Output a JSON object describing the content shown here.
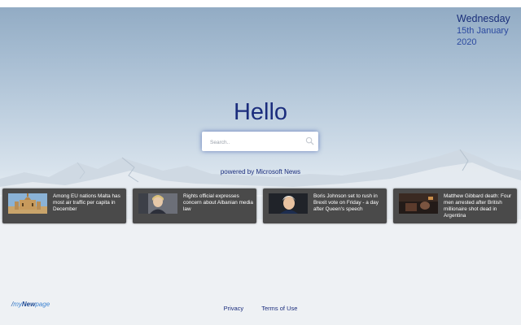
{
  "date": {
    "weekday": "Wednesday",
    "day_month": "15th January",
    "year": "2020"
  },
  "greeting": "Hello",
  "search": {
    "placeholder": "Search..",
    "icon": "search-icon"
  },
  "powered_by": "powered by Microsoft News",
  "news": [
    {
      "title": "Among EU nations Malta has most air traffic per capita in December",
      "image": "cathedral-photo"
    },
    {
      "title": "Rights official expresses concern about Albanian media law",
      "image": "woman-portrait-photo"
    },
    {
      "title": "Boris Johnson set to rush in Brexit vote on Friday - a day after Queen's speech",
      "image": "man-portrait-photo"
    },
    {
      "title": "Matthew Gibbard death: Four men arrested after British millionaire shot dead in Argentina",
      "image": "night-scene-photo"
    }
  ],
  "brand": {
    "prefix": "my",
    "bold": "New",
    "suffix": "page",
    "slash": "/"
  },
  "footer": {
    "privacy": "Privacy",
    "terms": "Terms of Use"
  },
  "colors": {
    "accent": "#1b2d7d",
    "card": "#4a4a4a",
    "search_glow": "#3c5aaa"
  }
}
